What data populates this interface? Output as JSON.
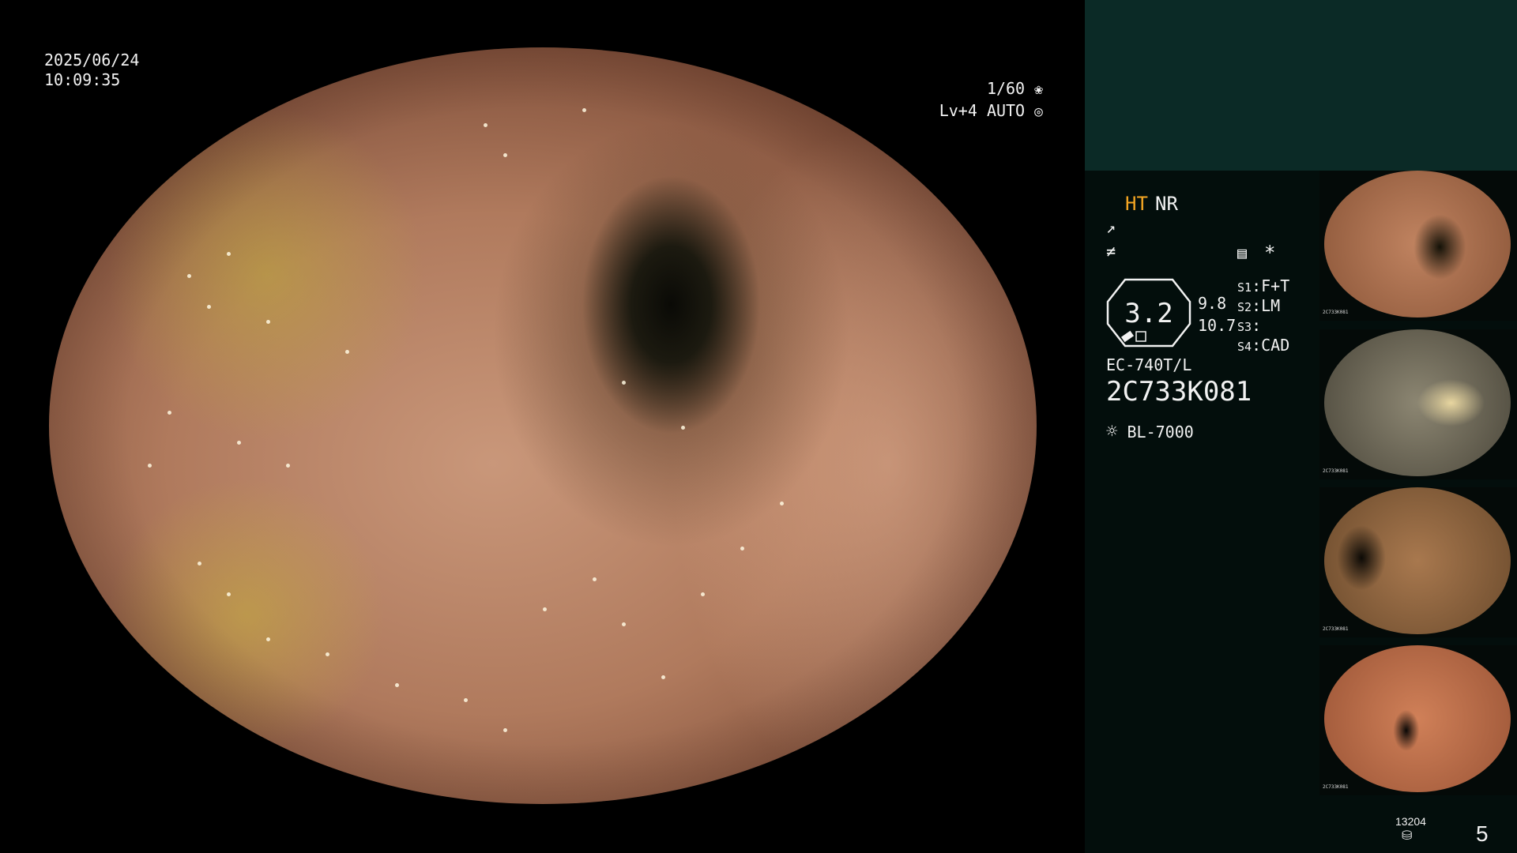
{
  "datetime": {
    "date": "2025/06/24",
    "time": "10:09:35"
  },
  "exposure": {
    "shutter": "1/60",
    "shutter_icon": "aperture-icon",
    "level": "Lv+4",
    "mode": "AUTO",
    "mode_icon": "iris-icon"
  },
  "status": {
    "ht_label": "HT",
    "nr_label": "NR",
    "ht_color": "#f5a623",
    "zoom_value": "3.2",
    "zoom_side_top": "9.8",
    "zoom_side_bottom": "10.7",
    "scope_model": "EC-740T/L",
    "serial": "2C733K081",
    "light_source": "BL-7000",
    "switches": [
      {
        "key": "S1",
        "value": "F+T"
      },
      {
        "key": "S2",
        "value": "LM"
      },
      {
        "key": "S3",
        "value": ""
      },
      {
        "key": "S4",
        "value": "CAD"
      }
    ],
    "asterisk": "*"
  },
  "thumbnails": [
    {
      "name": "thumb-1",
      "label": "2C733K081",
      "tone": "#c08360"
    },
    {
      "name": "thumb-2",
      "label": "2C733K081",
      "tone": "#8c8672"
    },
    {
      "name": "thumb-3",
      "label": "2C733K081",
      "tone": "#a8784e"
    },
    {
      "name": "thumb-4",
      "label": "2C733K081",
      "tone": "#d08058"
    }
  ],
  "footer": {
    "storage_count": "13204",
    "storage_icon": "disk-stack-icon",
    "image_count": "5"
  }
}
